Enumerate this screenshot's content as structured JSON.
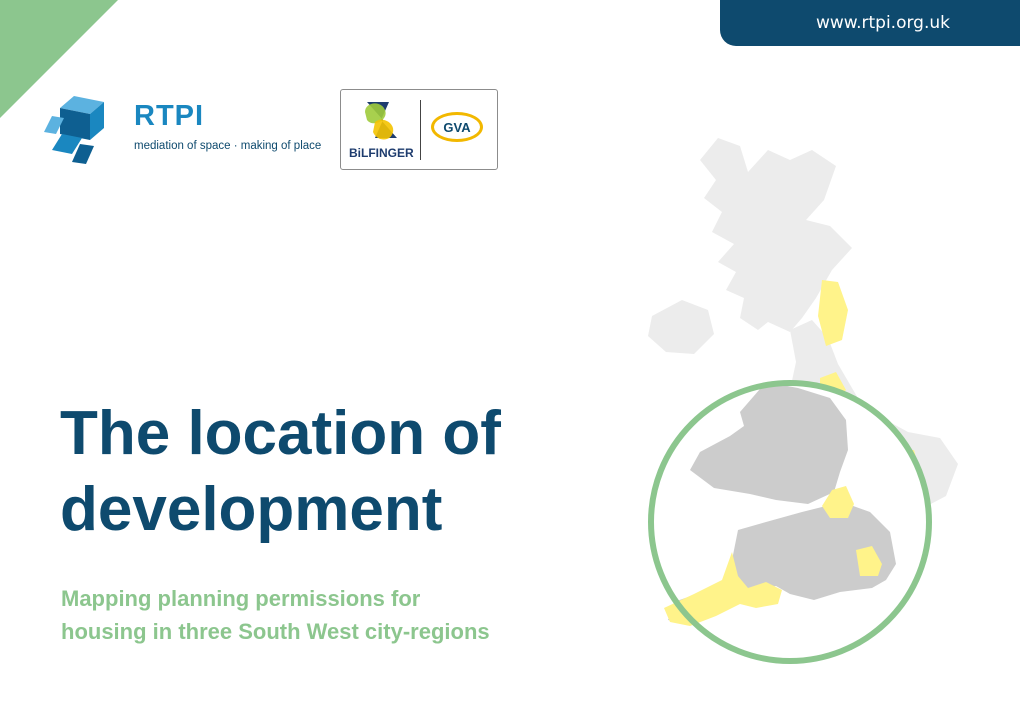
{
  "header": {
    "url": "www.rtpi.org.uk"
  },
  "logos": {
    "rtpi": {
      "name": "RTPI",
      "tagline": "mediation of space · making of place",
      "icon": "rtpi-cube-icon"
    },
    "partners": [
      {
        "name": "BiLFINGER",
        "icon": "bilfinger-mark-icon"
      },
      {
        "name": "GVA",
        "icon": "gva-badge-icon"
      }
    ]
  },
  "main": {
    "title_line1": "The location of",
    "title_line2": "development",
    "subtitle_line1": "Mapping planning permissions for",
    "subtitle_line2": "housing in three South West city-regions"
  },
  "colors": {
    "navy": "#0e4a6e",
    "green": "#8cc68e",
    "map_grey": "#ececec",
    "map_focus": "#cccccc",
    "highlight_yellow": "#fff38a"
  }
}
